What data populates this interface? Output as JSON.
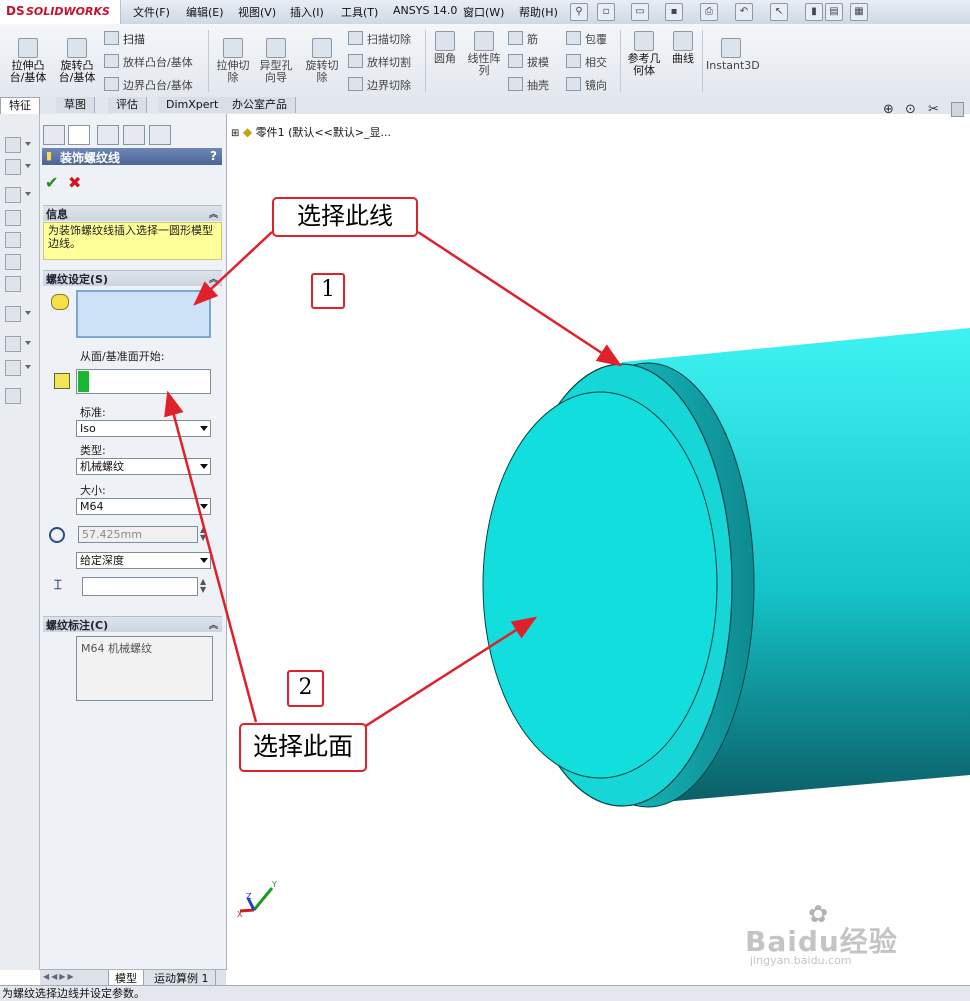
{
  "app": {
    "logo_ds": "DS",
    "logo_text": "SOLIDWORKS"
  },
  "menu": [
    "文件(F)",
    "编辑(E)",
    "视图(V)",
    "插入(I)",
    "工具(T)",
    "ANSYS 14.0",
    "窗口(W)",
    "帮助(H)"
  ],
  "ribbon": {
    "extrude_boss": "拉伸凸\n台/基体",
    "revolve_boss": "旋转凸\n台/基体",
    "sweep": "扫描",
    "loft_boss": "放样凸台/基体",
    "boundary_boss": "边界凸台/基体",
    "extrude_cut": "拉伸切\n除",
    "hole_wizard": "异型孔\n向导",
    "revolve_cut": "旋转切\n除",
    "sweep_cut": "扫描切除",
    "loft_cut": "放样切割",
    "boundary_cut": "边界切除",
    "fillet": "圆角",
    "linear_pattern": "线性阵\n列",
    "rib": "筋",
    "draft": "拔模",
    "shell": "抽壳",
    "wrap": "包覆",
    "intersect": "相交",
    "mirror": "镜向",
    "ref_geometry": "参考几\n何体",
    "curves": "曲线",
    "instant3d": "Instant3D"
  },
  "tabs": [
    "特征",
    "草图",
    "评估",
    "DimXpert",
    "办公室产品"
  ],
  "tree": {
    "root": "零件1 (默认<<默认>_显..."
  },
  "panel": {
    "title": "装饰螺纹线",
    "help": "?",
    "info_header": "信息",
    "info_text": "为装饰螺纹线插入选择一圆形模型边线。",
    "thread_settings_header": "螺纹设定(S)",
    "start_from_label": "从面/基准面开始:",
    "standard_label": "标准:",
    "standard_value": "Iso",
    "type_label": "类型:",
    "type_value": "机械螺纹",
    "size_label": "大小:",
    "size_value": "M64",
    "diameter_value": "57.425mm",
    "end_condition": "给定深度",
    "callout_header": "螺纹标注(C)",
    "callout_text": "M64 机械螺纹"
  },
  "bottom_tabs": [
    "模型",
    "运动算例 1"
  ],
  "status": "为螺纹选择边线并设定参数。",
  "annotations": {
    "select_line": "选择此线",
    "select_face": "选择此面",
    "num1": "1",
    "num2": "2"
  },
  "axes": {
    "x": "X",
    "y": "Y",
    "z": "Z"
  },
  "watermark": {
    "brand": "Baidu经验",
    "url": "jingyan.baidu.com"
  },
  "colors": {
    "part": "#19dcdc",
    "arrow": "#e0202a",
    "title_bar": "#4c6597",
    "info_bg": "#ffff99"
  }
}
